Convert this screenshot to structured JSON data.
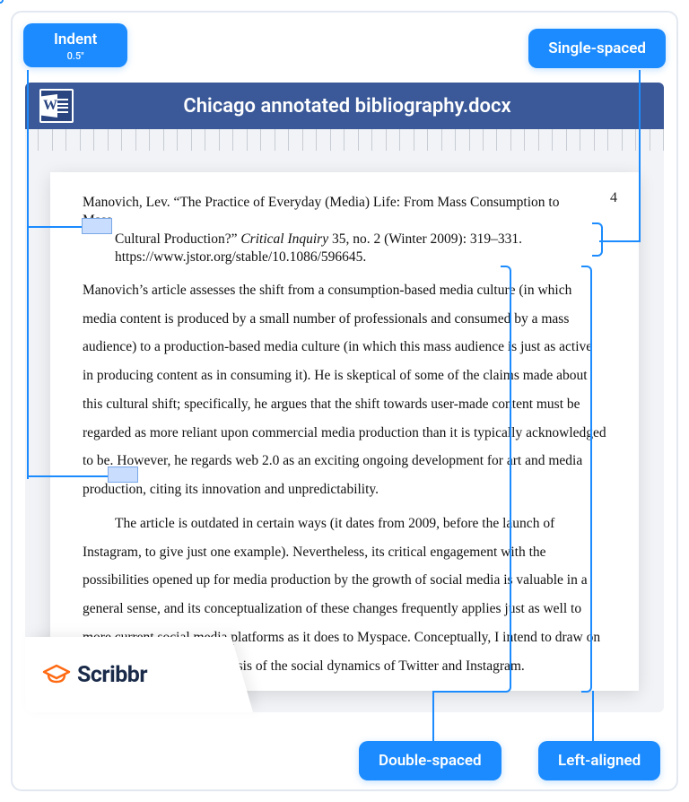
{
  "tags": {
    "indent": {
      "title": "Indent",
      "sub": "0.5\""
    },
    "single": "Single-spaced",
    "double": "Double-spaced",
    "left": "Left-aligned"
  },
  "titlebar": {
    "filename": "Chicago annotated bibliography.docx"
  },
  "page": {
    "number": "4",
    "citation": {
      "line1_pre": "Manovich, Lev. “The Practice of Everyday (Media) Life: From Mass Consumption to Mass",
      "line2_pre": "Cultural Production?” ",
      "line2_em": "Critical Inquiry",
      "line2_post": " 35, no. 2 (Winter 2009): 319–331.",
      "line3": "https://www.jstor.org/stable/10.1086/596645."
    },
    "annotation": {
      "p1": "Manovich’s article assesses the shift from a consumption-based media culture (in which media content is produced by a small number of professionals and consumed by a mass audience) to a production-based media culture (in which this mass audience is just as active in producing content as in consuming it). He is skeptical of some of the claims made about this cultural shift; specifically, he argues that the shift towards user-made content must be regarded as more reliant upon commercial media production than it is typically acknowledged to be. However, he regards web 2.0 as an exciting ongoing development for art and media production, citing its innovation and unpredictability.",
      "p2": "The article is outdated in certain ways (it dates from 2009, before the launch of Instagram, to give just one example). Nevertheless, its critical engagement with the possibilities opened up for media production by the growth of social media is valuable in a general sense, and its conceptualization of these changes frequently applies just as well to more current social media platforms as it does to Myspace. Conceptually, I intend to draw on this article in my own analysis of the social dynamics of Twitter and Instagram."
    }
  },
  "brand": {
    "name": "Scribbr"
  }
}
